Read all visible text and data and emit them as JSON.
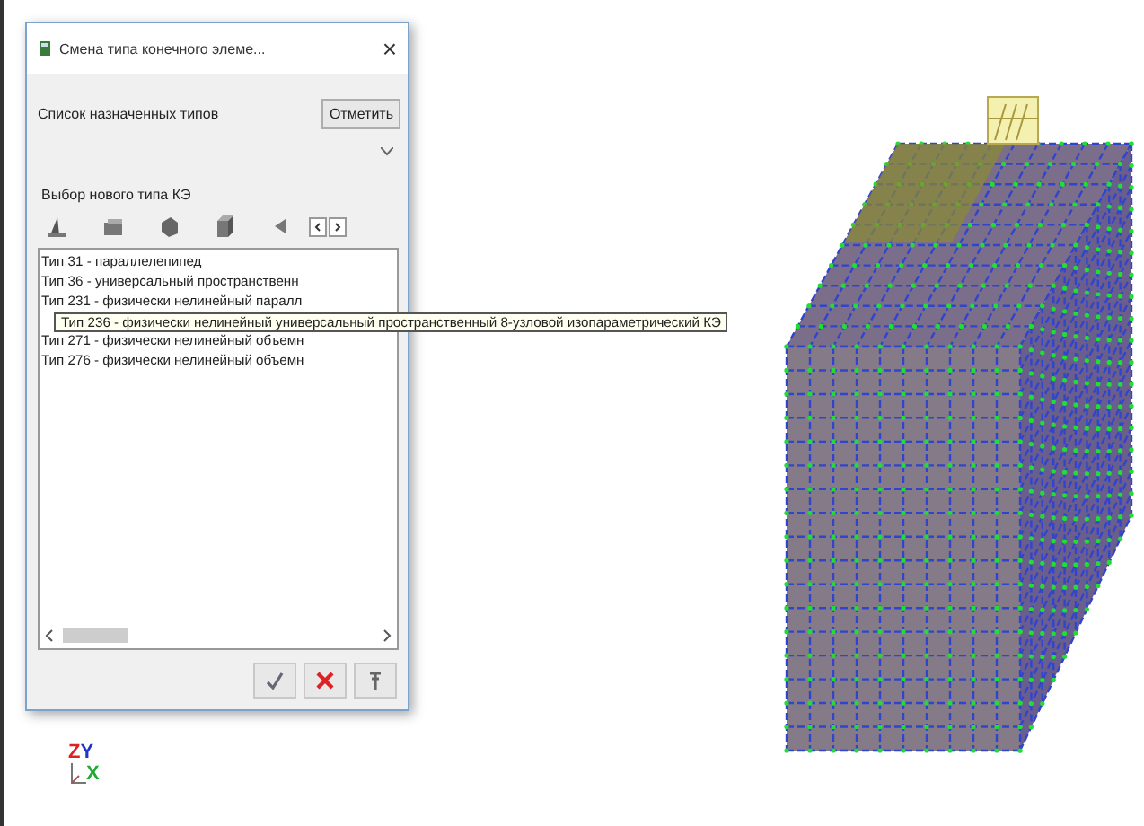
{
  "dialog": {
    "title": "Смена типа конечного элеме...",
    "close": "×",
    "assigned_label": "Список назначенных типов",
    "mark_button": "Отметить",
    "new_type_label": "Выбор нового типа КЭ",
    "types": [
      {
        "label": "Тип 31 - параллелепипед"
      },
      {
        "label": "Тип 36 - универсальный пространственн"
      },
      {
        "label": "Тип 231 - физически нелинейный паралл"
      },
      {
        "label": "Тип 271 - физически нелинейный объемн"
      },
      {
        "label": "Тип 276 - физически нелинейный объемн"
      }
    ],
    "tooltip": "Тип 236 - физически нелинейный универсальный пространственный 8-узловой изопараметрический КЭ"
  },
  "axes": {
    "z": "Z",
    "y": "Y",
    "x": "X"
  }
}
